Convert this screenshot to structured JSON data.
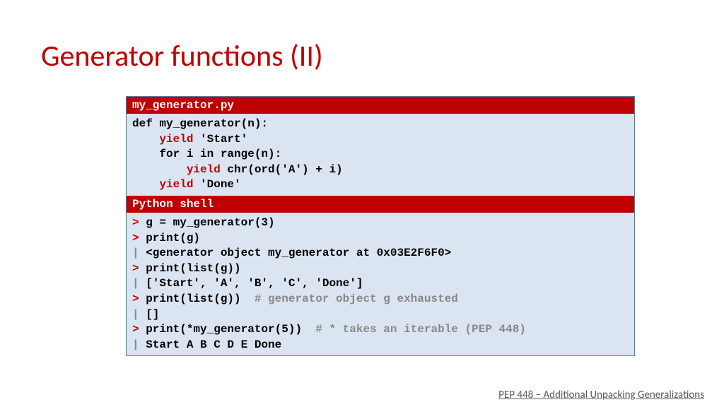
{
  "title": "Generator functions (II)",
  "file_header": "my_generator.py",
  "code": {
    "l1a": "def my_generator(n):",
    "l2a": "    ",
    "l2b": "yield",
    "l2c": " 'Start'",
    "l3a": "    for i in range(n):",
    "l4a": "        ",
    "l4b": "yield",
    "l4c": " chr(ord('A') + i)",
    "l5a": "    ",
    "l5b": "yield",
    "l5c": " 'Done'"
  },
  "shell_header": "Python shell",
  "shell": {
    "p1": "> ",
    "s1": "g = my_generator(3)",
    "p2": "> ",
    "s2": "print(g)",
    "p3": "| ",
    "s3": "<generator object my_generator at 0x03E2F6F0>",
    "p4": "> ",
    "s4": "print(list(g))",
    "p5": "| ",
    "s5": "['Start', 'A', 'B', 'C', 'Done']",
    "p6": "> ",
    "s6": "print(list(g))  ",
    "c6": "# generator object g exhausted",
    "p7": "| ",
    "s7": "[]",
    "p8": "> ",
    "s8": "print(*my_generator(5))  ",
    "c8": "# * takes an iterable (PEP 448)",
    "p9": "| ",
    "s9": "Start A B C D E Done"
  },
  "footer": "PEP 448 – Additional Unpacking Generalizations"
}
